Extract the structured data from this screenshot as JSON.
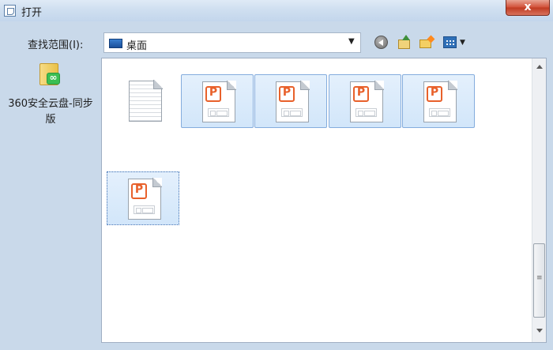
{
  "window": {
    "title": "打开",
    "close_glyph": "x"
  },
  "toolbar": {
    "lookin_label": "查找范围(I):",
    "lookin_value": "桌面",
    "icons": [
      "back-icon",
      "up-folder-icon",
      "new-folder-icon",
      "views-menu-icon"
    ]
  },
  "places": {
    "items": [
      {
        "label": "360安全云盘-同步版",
        "icon": "360-cloud-folder-icon"
      }
    ]
  },
  "files": [
    {
      "type": "text-document",
      "icon": "text-document-icon",
      "selected": false
    },
    {
      "type": "presentation",
      "icon": "wps-presentation-icon",
      "selected": true
    },
    {
      "type": "presentation",
      "icon": "wps-presentation-icon",
      "selected": true
    },
    {
      "type": "presentation",
      "icon": "wps-presentation-icon",
      "selected": true
    },
    {
      "type": "presentation",
      "icon": "wps-presentation-icon",
      "selected": true
    },
    {
      "type": "presentation",
      "icon": "wps-presentation-icon",
      "selected": true,
      "focused": true
    }
  ],
  "scrollbar": {
    "grip_glyph": "≡"
  },
  "colors": {
    "accent_selection": "#d2e6fa",
    "close_button": "#c03b22",
    "wps_orange": "#e8612b"
  }
}
